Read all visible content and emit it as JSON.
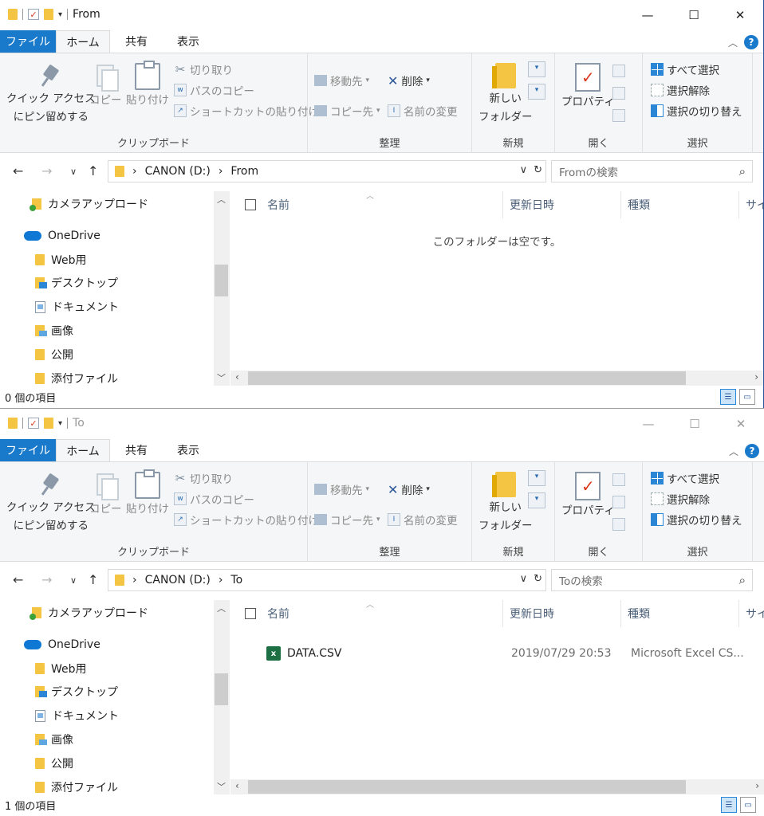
{
  "ribbon": {
    "tabs": {
      "file": "ファイル",
      "home": "ホーム",
      "share": "共有",
      "view": "表示"
    },
    "clipboard": {
      "pin_quick": "クイック アクセス",
      "pin_quick2": "にピン留めする",
      "copy": "コピー",
      "paste": "貼り付け",
      "cut": "切り取り",
      "copy_path": "パスのコピー",
      "paste_shortcut": "ショートカットの貼り付け",
      "label": "クリップボード"
    },
    "organize": {
      "move_to": "移動先",
      "copy_to": "コピー先",
      "delete": "削除",
      "rename": "名前の変更",
      "label": "整理"
    },
    "new": {
      "new_folder1": "新しい",
      "new_folder2": "フォルダー",
      "label": "新規"
    },
    "open": {
      "properties": "プロパティ",
      "label": "開く"
    },
    "select": {
      "select_all": "すべて選択",
      "select_none": "選択解除",
      "invert": "選択の切り替え",
      "label": "選択"
    }
  },
  "nav_items": [
    "カメラアップロード",
    "OneDrive",
    "Web用",
    "デスクトップ",
    "ドキュメント",
    "画像",
    "公開",
    "添付ファイル"
  ],
  "columns": {
    "name": "名前",
    "date": "更新日時",
    "type": "種類",
    "size": "サイ"
  },
  "windows": [
    {
      "title": "From",
      "path": {
        "drive": "CANON (D:)",
        "folder": "From"
      },
      "search_placeholder": "Fromの検索",
      "empty_message": "このフォルダーは空です。",
      "status": "0 個の項目"
    },
    {
      "title": "To",
      "path": {
        "drive": "CANON (D:)",
        "folder": "To"
      },
      "search_placeholder": "Toの検索",
      "files": [
        {
          "name": "DATA.CSV",
          "date": "2019/07/29 20:53",
          "type": "Microsoft Excel CS..."
        }
      ],
      "status": "1 個の項目"
    }
  ],
  "colors": {
    "accent": "#1979ca",
    "folder": "#f4c542",
    "excel": "#1d7044"
  }
}
